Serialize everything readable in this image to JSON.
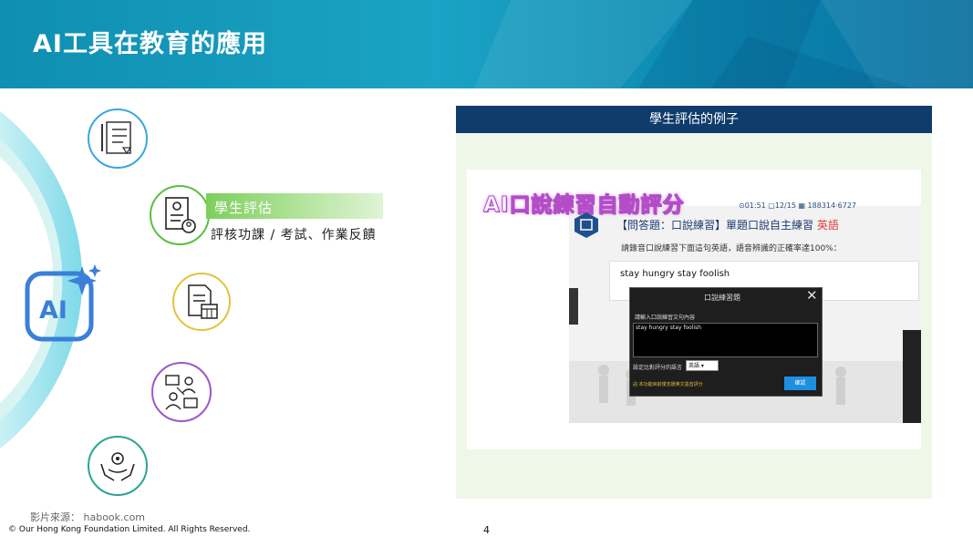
{
  "header": {
    "title": "AI工具在教育的應用"
  },
  "center": {
    "ai_label": "AI"
  },
  "items": [
    {
      "icon": "checklist-icon"
    },
    {
      "icon": "assessment-icon",
      "label": "學生評估",
      "description": "評核功課 / 考試、作業反饋"
    },
    {
      "icon": "document-calendar-icon"
    },
    {
      "icon": "collaboration-icon"
    },
    {
      "icon": "care-hands-icon"
    }
  ],
  "panel": {
    "heading": "學生評估的例子",
    "video": {
      "overlay_title": "AI口說練習自動評分",
      "topbar": "⊙01:51  ▢12/15  ▦ 188314·6727",
      "question_title": "【問答題：口說練習】單題口說自主練習",
      "question_lang": "英語",
      "question_desc": "請錄音口說練習下面這句英語，語音辨識的正確率達100%：",
      "answer": "stay hungry stay foolish",
      "dialog": {
        "title": "口說練習題",
        "close": "✕",
        "input_label": "請輸入口說練習文句內容",
        "input_value": "stay hungry stay foolish",
        "lang_label": "設定比對評分的語言",
        "lang_value": "英語",
        "note": "註:本功能目前僅支援英文語音評分",
        "ok": "確認"
      }
    }
  },
  "footer": {
    "source": "影片來源： habook.com",
    "copyright": "© Our Hong Kong Foundation Limited. All Rights Reserved.",
    "page": "4"
  },
  "colors": {
    "header": "#1aa3c4",
    "panel_head": "#0f3c6b",
    "highlight": "#7ccf5a",
    "arc": "#6fd6e6"
  }
}
